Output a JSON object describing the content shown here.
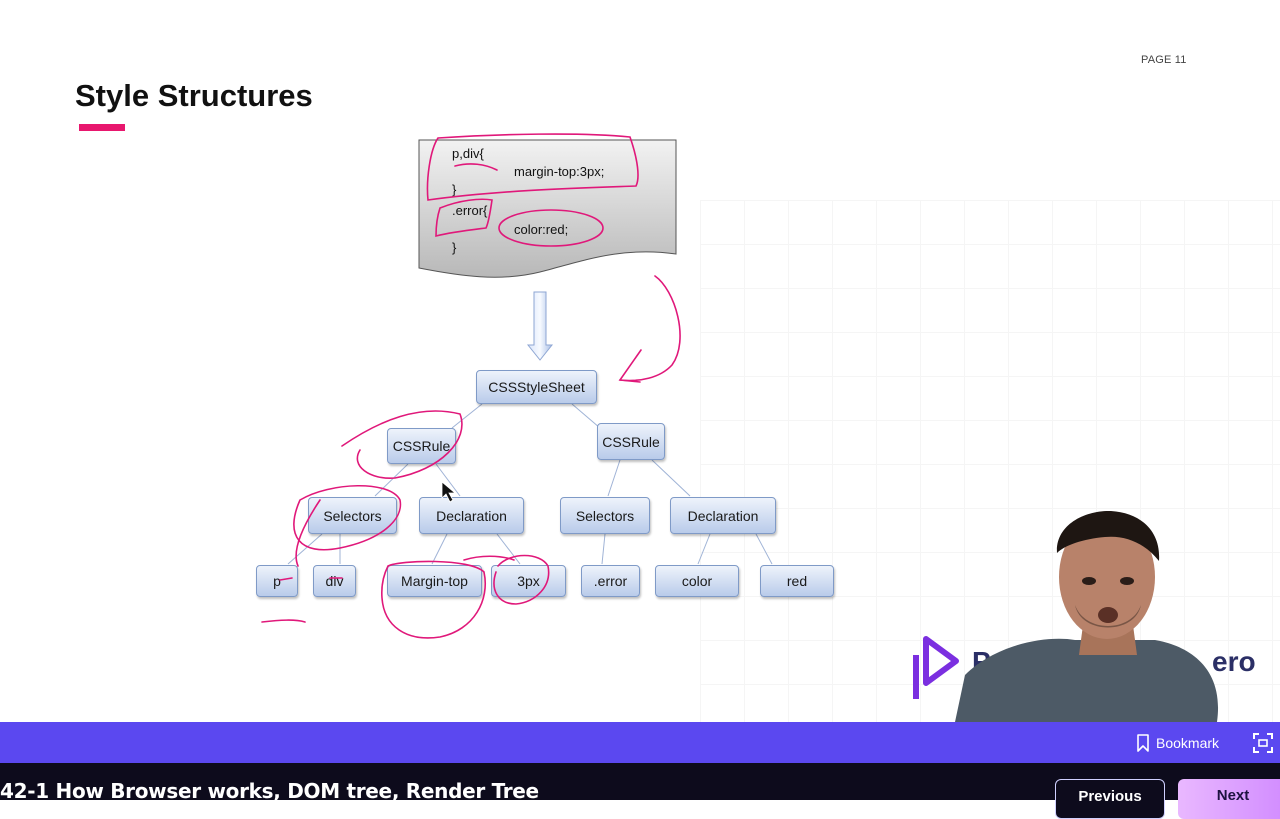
{
  "slide": {
    "page_label": "PAGE 11",
    "title": "Style Structures",
    "accent_color": "#e8176e",
    "code": {
      "line1": "p,div{",
      "line2": "margin-top:3px;",
      "line3": "}",
      "line4": ".error{",
      "line5": "color:red;",
      "line6": "}"
    },
    "tree": {
      "root": "CSSStyleSheet",
      "rule_left": "CSSRule",
      "rule_right": "CSSRule",
      "selectors_left": "Selectors",
      "declaration_left": "Declaration",
      "selectors_right": "Selectors",
      "declaration_right": "Declaration",
      "leaf_p": "p",
      "leaf_div": "div",
      "leaf_margin_top": "Margin-top",
      "leaf_3px": "3px",
      "leaf_error": ".error",
      "leaf_color": "color",
      "leaf_red": "red"
    },
    "annotation_color": "#e0187a"
  },
  "video": {
    "brand_partial_left": "Pr",
    "brand_partial_right": "ero"
  },
  "toolbar": {
    "bookmark_label": "Bookmark",
    "bar_color": "#5b48f0"
  },
  "footer": {
    "lesson_title": "42-1 How Browser works, DOM tree, Render Tree",
    "previous_label": "Previous",
    "next_label": "Next"
  }
}
